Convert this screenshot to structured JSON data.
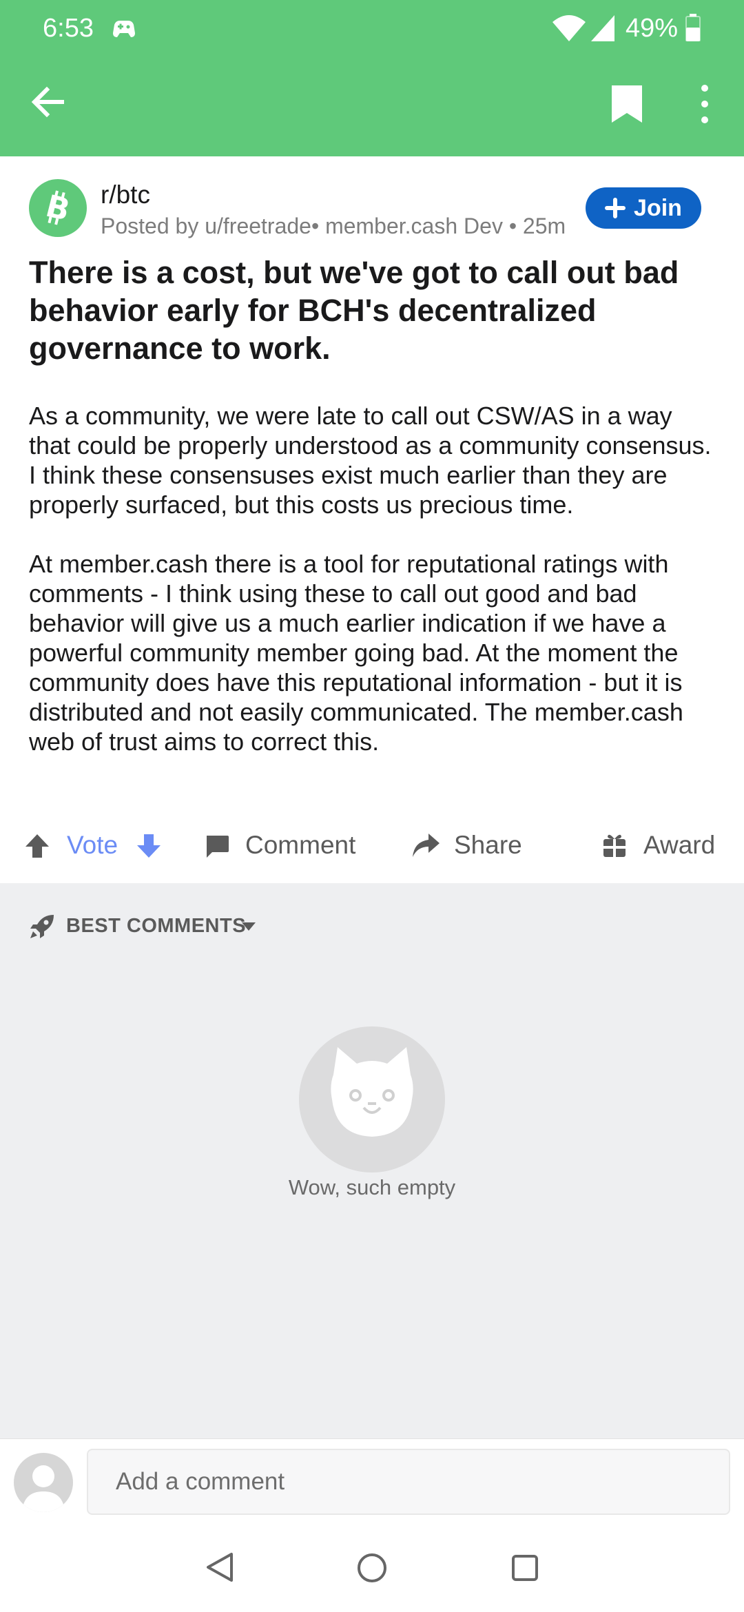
{
  "status": {
    "time": "6:53",
    "battery": "49%"
  },
  "toolbar": {
    "back_icon": "arrow-left-icon",
    "bookmark_icon": "bookmark-icon",
    "more_icon": "more-vertical-icon"
  },
  "post": {
    "subreddit": "r/btc",
    "meta": "Posted by u/freetrade• member.cash Dev • 25m",
    "join_label": "Join",
    "title": "There is a cost, but we've got to call out bad behavior early for BCH's decentralized governance to work.",
    "paragraphs": [
      "As a community, we were late to call out CSW/AS in a way that could be properly understood as a community consensus. I think these consensuses exist much earlier than they are properly surfaced, but this costs us precious time.",
      "At member.cash there is a tool for reputational ratings with comments - I think using these to call out good and bad behavior will give us a much earlier indication if we have a powerful community member going bad. At the moment the community does have this reputational information - but it is distributed and not easily communicated. The member.cash web of trust aims to correct this."
    ]
  },
  "actions": {
    "vote": "Vote",
    "comment": "Comment",
    "share": "Share",
    "award": "Award"
  },
  "comments": {
    "sort_label": "BEST COMMENTS",
    "empty_text": "Wow, such empty"
  },
  "comment_bar": {
    "placeholder": "Add a comment"
  },
  "colors": {
    "header": "#5fc97a",
    "join": "#0f63c5",
    "vote": "#6b8cf5",
    "comments_bg": "#eeeff1"
  }
}
